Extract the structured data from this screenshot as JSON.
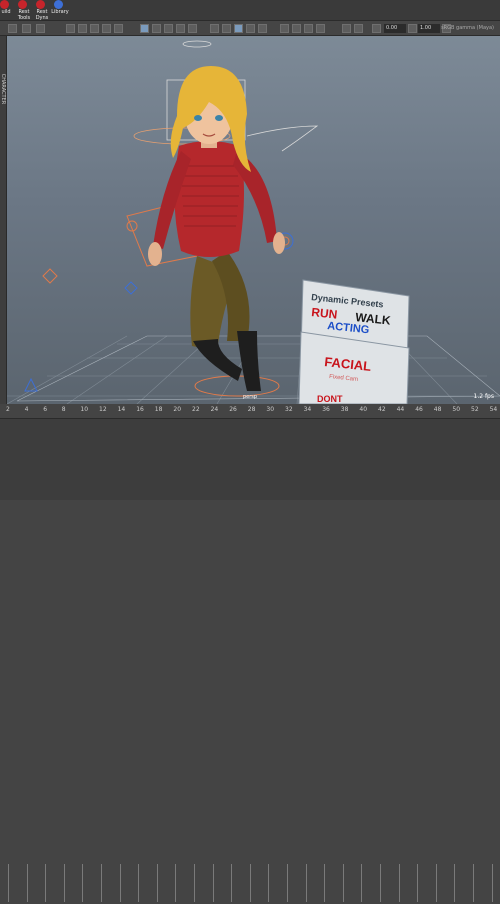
{
  "shelf": {
    "items": [
      {
        "label": "uild",
        "icon": "build-icon"
      },
      {
        "label": "Rest Tools",
        "icon": "tools-icon"
      },
      {
        "label": "Rest Dyns",
        "icon": "dyns-icon"
      },
      {
        "label": "Library",
        "icon": "library-icon"
      }
    ]
  },
  "toolbar": {
    "value_a": "0.00",
    "value_b": "1.00",
    "camera_label": "sRGB gamma (Maya)"
  },
  "left_bar": {
    "label": "CHARACTER"
  },
  "viewport": {
    "sign_dynamic": {
      "title": "Dynamic Presets",
      "run": "RUN",
      "walk": "WALK",
      "acting": "ACTING"
    },
    "sign_facial": {
      "title": "FACIAL",
      "subtitle": "Fixed Cam"
    },
    "sign_partial": "DONT",
    "persp_label": "persp",
    "fps": "1.2 fps"
  },
  "timeline": {
    "ticks": [
      "2",
      "4",
      "6",
      "8",
      "10",
      "12",
      "14",
      "16",
      "18",
      "20",
      "22",
      "24",
      "26",
      "28",
      "30",
      "32",
      "34",
      "36",
      "38",
      "40",
      "42",
      "44",
      "46",
      "48",
      "50",
      "52",
      "54"
    ]
  },
  "colors": {
    "shelf_icon": "#c6242b",
    "viewport_top": "#7d8a97",
    "viewport_bottom": "#5b656f",
    "control_orange": "#e07a4a",
    "control_blue": "#3d6fd6",
    "sign_red": "#c8141c",
    "sign_blue": "#1c4fc8"
  }
}
